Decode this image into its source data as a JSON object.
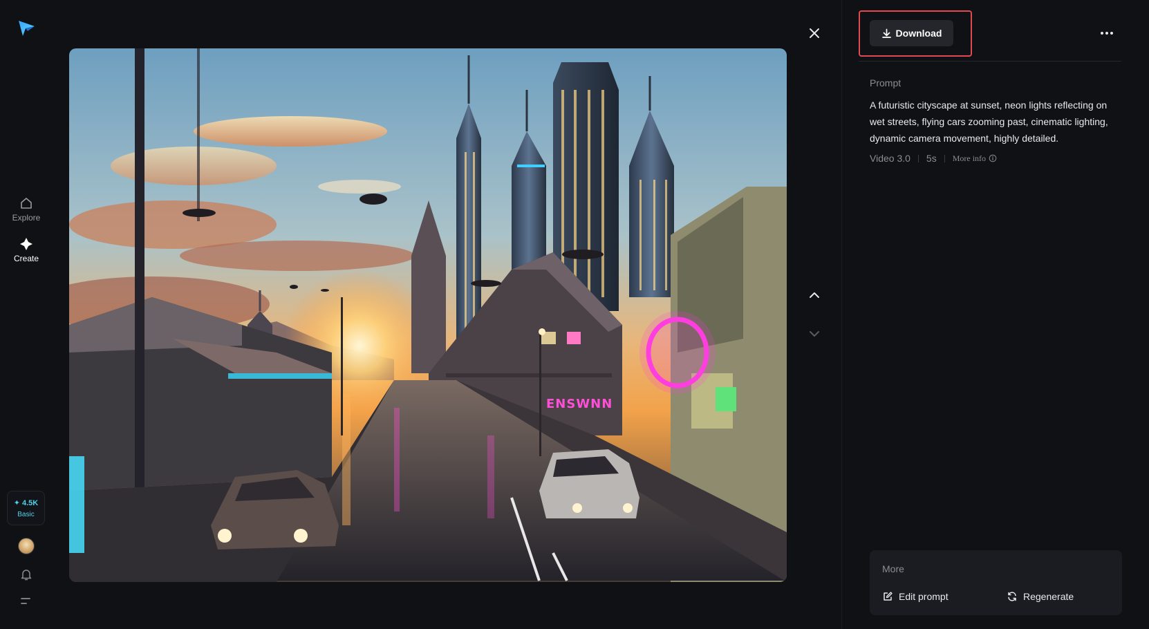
{
  "sidebar": {
    "logo_icon": "paper-plane-logo-icon",
    "items": [
      {
        "label": "Explore",
        "icon": "home-icon"
      },
      {
        "label": "Create",
        "icon": "sparkle-icon"
      }
    ],
    "credits": {
      "amount": "✦ 4.5K",
      "plan": "Basic"
    }
  },
  "viewer": {
    "image_description": "Futuristic city at sunset with neon signs, flying cars and wet street",
    "close_icon": "close-icon",
    "prev_icon": "chevron-up-icon",
    "next_icon": "chevron-down-icon"
  },
  "panel": {
    "download_label": "Download",
    "prompt_label": "Prompt",
    "prompt_text": "A futuristic cityscape at sunset, neon lights reflecting on wet streets, flying cars zooming past, cinematic lighting, dynamic camera movement, highly detailed.",
    "model": "Video 3.0",
    "duration": "5s",
    "more_info": "More info",
    "more": {
      "title": "More",
      "actions": [
        {
          "label": "Edit prompt",
          "icon": "edit-icon"
        },
        {
          "label": "Regenerate",
          "icon": "refresh-icon"
        }
      ]
    }
  },
  "colors": {
    "background": "#101115",
    "accent": "#4fd1e8",
    "highlight": "#e14a52",
    "button": "#25262c"
  }
}
